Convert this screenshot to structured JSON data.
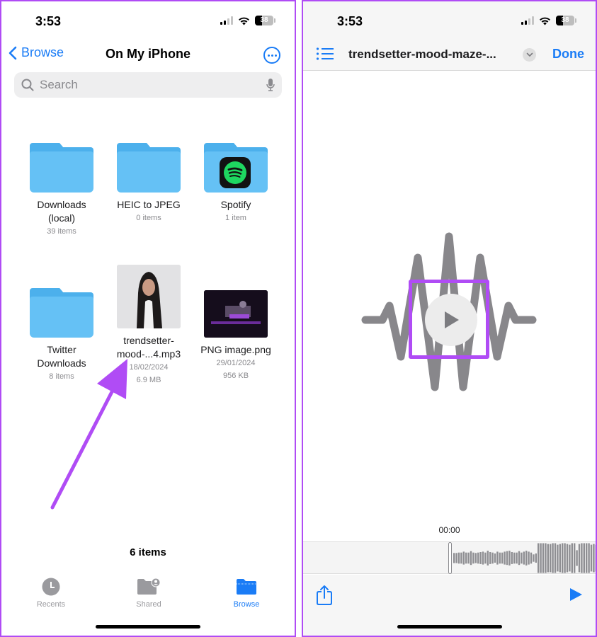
{
  "status_bar": {
    "time": "3:53",
    "battery": "38"
  },
  "files_screen": {
    "back_label": "Browse",
    "title": "On My iPhone",
    "search_placeholder": "Search",
    "items": [
      {
        "name": "Downloads (local)",
        "meta": [
          "39 items"
        ],
        "type": "folder"
      },
      {
        "name": "HEIC to JPEG",
        "meta": [
          "0 items"
        ],
        "type": "folder"
      },
      {
        "name": "Spotify",
        "meta": [
          "1 item"
        ],
        "type": "folder-spotify"
      },
      {
        "name": "Twitter Downloads",
        "meta": [
          "8 items"
        ],
        "type": "folder"
      },
      {
        "name": "trendsetter-mood-...4.mp3",
        "meta": [
          "18/02/2024",
          "6.9 MB"
        ],
        "type": "audio-thumbnail"
      },
      {
        "name": "PNG image.png",
        "meta": [
          "29/01/2024",
          "956 KB"
        ],
        "type": "image-thumbnail"
      }
    ],
    "items_count": "6 items",
    "tabs": [
      {
        "label": "Recents",
        "icon": "clock-icon",
        "active": false
      },
      {
        "label": "Shared",
        "icon": "shared-folder-icon",
        "active": false
      },
      {
        "label": "Browse",
        "icon": "folder-icon",
        "active": true
      }
    ]
  },
  "player_screen": {
    "title": "trendsetter-mood-maze-...",
    "done_label": "Done",
    "current_time": "00:00",
    "waveform_levels": [
      0.55,
      0.55,
      0.6,
      0.6,
      0.7,
      0.6,
      0.6,
      0.75,
      0.6,
      0.55,
      0.6,
      0.65,
      0.7,
      0.6,
      0.8,
      0.65,
      0.6,
      0.5,
      0.7,
      0.6,
      0.6,
      0.7,
      0.75,
      0.8,
      0.65,
      0.6,
      0.6,
      0.75,
      0.6,
      0.7,
      0.8,
      0.7,
      0.6,
      0.4,
      0.5,
      1.0,
      1.0,
      1.0,
      1.0,
      0.95,
      0.95,
      1.0,
      1.0,
      0.9,
      0.95,
      1.0,
      1.0,
      0.95,
      0.9,
      1.0,
      1.0,
      0.85,
      0.95,
      1.0,
      1.0,
      1.0,
      1.0,
      0.9,
      0.95,
      0.9,
      1.0
    ]
  },
  "colors": {
    "accent": "#1a7cf6",
    "annotation": "#b04cf5",
    "folder": "#65c1f5",
    "spotify_green": "#1ed760"
  }
}
